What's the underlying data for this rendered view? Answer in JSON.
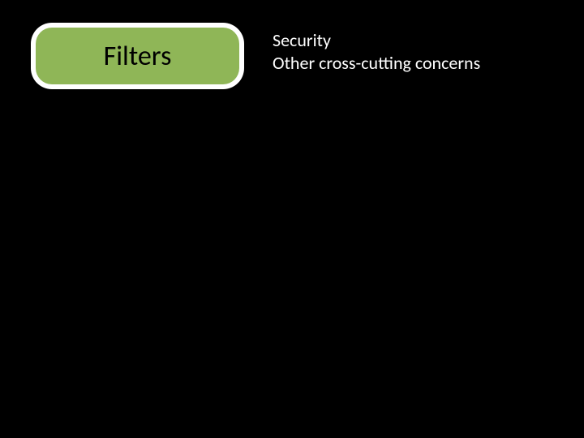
{
  "badge": {
    "title": "Filters"
  },
  "description": {
    "line1": "Security",
    "line2": "Other cross-cutting concerns"
  }
}
